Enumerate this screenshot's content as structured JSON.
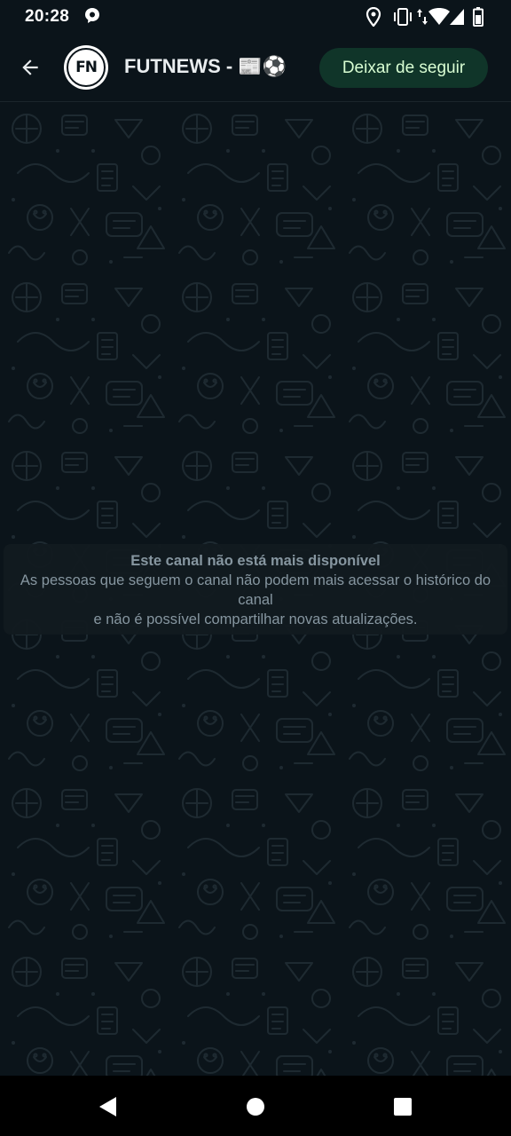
{
  "status_bar": {
    "time": "20:28",
    "icons": [
      "whatsapp-status-icon",
      "location-icon",
      "vibrate-icon",
      "data-transfer-icon",
      "wifi-icon",
      "signal-icon",
      "battery-icon"
    ]
  },
  "header": {
    "back_icon": "arrow-back-icon",
    "avatar_initials": "FN",
    "title": "FUTNEWS - 📰⚽",
    "unfollow_label": "Deixar de seguir"
  },
  "notice": {
    "title": "Este canal não está mais disponível",
    "line1": "As pessoas que seguem o canal não podem mais acessar o histórico do canal",
    "line2": "e não é possível compartilhar novas atualizações."
  },
  "nav_bar": {
    "icons": [
      "back-triangle-icon",
      "home-circle-icon",
      "recents-square-icon"
    ]
  },
  "colors": {
    "background": "#0b141a",
    "button_bg": "#103529",
    "button_text": "#d8fdd2",
    "muted_text": "#8696a0"
  }
}
